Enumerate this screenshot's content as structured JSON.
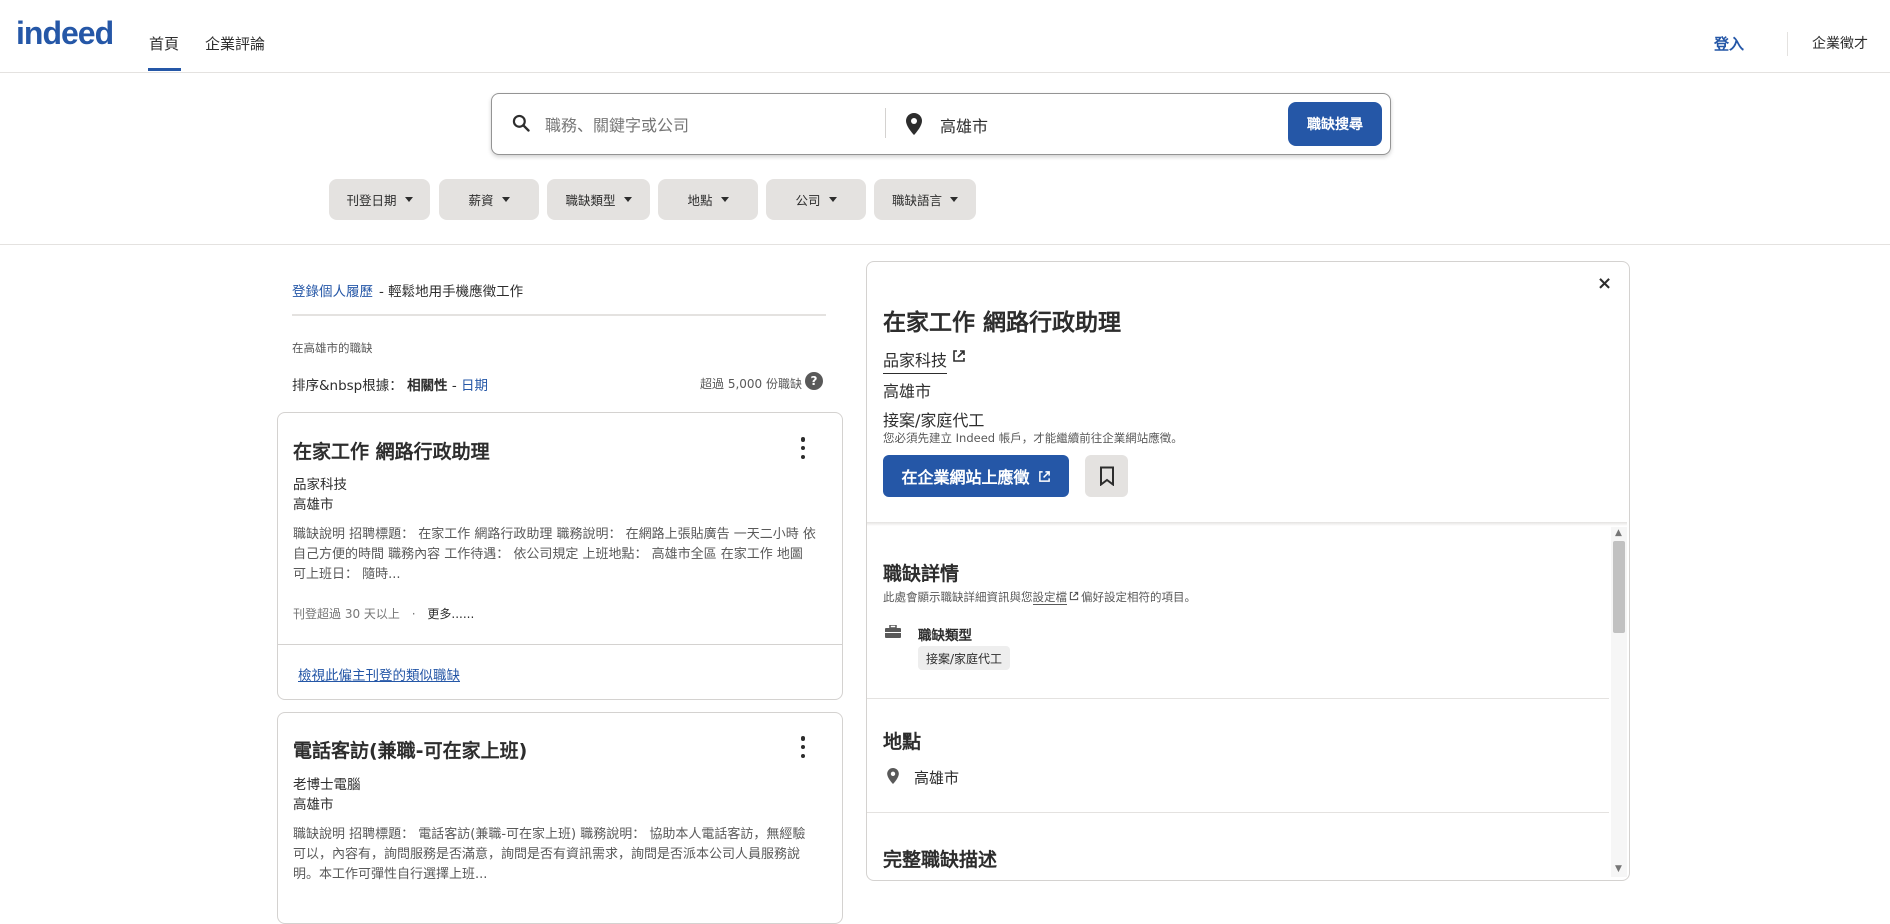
{
  "header": {
    "logo": "indeed",
    "nav": [
      {
        "label": "首頁",
        "active": true
      },
      {
        "label": "企業評論",
        "active": false
      }
    ],
    "signin": "登入",
    "employers": "企業徵才"
  },
  "search": {
    "what_placeholder": "職務、關鍵字或公司",
    "what_value": "",
    "where_value": "高雄市",
    "button": "職缺搜尋"
  },
  "filters": [
    "刊登日期",
    "薪資",
    "職缺類型",
    "地點",
    "公司",
    "職缺語言"
  ],
  "promo": {
    "link": "登錄個人履歷",
    "text": " - 輕鬆地用手機應徵工作"
  },
  "results": {
    "heading": "在高雄市的職缺",
    "sort_prefix": "排序&nbsp根據：",
    "sort_relevance": "相關性",
    "sort_sep": " - ",
    "sort_date": "日期",
    "count": "超過 5,000 份職缺",
    "help": "?"
  },
  "jobs": [
    {
      "title": "在家工作 網路行政助理",
      "company": "品家科技",
      "location": "高雄市",
      "snippet_lines": [
        "職缺說明 招聘標題： 在家工作 網路行政助理 職務說明： 在網路上張貼廣告 一天二小時 依",
        "自己方便的時間 職務內容 工作待遇： 依公司規定 上班地點： 高雄市全區 在家工作 地圖",
        "可上班日： 隨時..."
      ],
      "posted": "刊登超過 30 天以上",
      "meta_sep": "·",
      "more": "更多......",
      "similar_link": "檢視此僱主刊登的類似職缺"
    },
    {
      "title": "電話客訪(兼職-可在家上班)",
      "company": "老博士電腦",
      "location": "高雄市",
      "snippet_lines": [
        "職缺說明 招聘標題： 電話客訪(兼職-可在家上班) 職務說明： 協助本人電話客訪，無經驗",
        "可以，內容有，詢問服務是否滿意，詢問是否有資訊需求，詢問是否派本公司人員服務說",
        "明。本工作可彈性自行選擇上班..."
      ]
    }
  ],
  "detail": {
    "close": "×",
    "title": "在家工作 網路行政助理",
    "company": "品家科技",
    "location": "高雄市",
    "job_type": "接案/家庭代工",
    "notice": "您必須先建立 Indeed 帳戶，才能繼續前往企業網站應徵。",
    "apply_button": "在企業網站上應徵",
    "details_heading": "職缺詳情",
    "details_sub_a": "此處會顯示職缺詳細資訊與您",
    "details_sub_link": "設定檔",
    "details_sub_b": "偏好設定相符的項目。",
    "jobtype_label": "職缺類型",
    "jobtype_tag": "接案/家庭代工",
    "location_heading": "地點",
    "location_value": "高雄市",
    "description_heading": "完整職缺描述"
  },
  "colors": {
    "brand_blue": "#2557a7",
    "logo_dot": "#ff6f3d",
    "filter_bg": "#e4e2e0"
  }
}
